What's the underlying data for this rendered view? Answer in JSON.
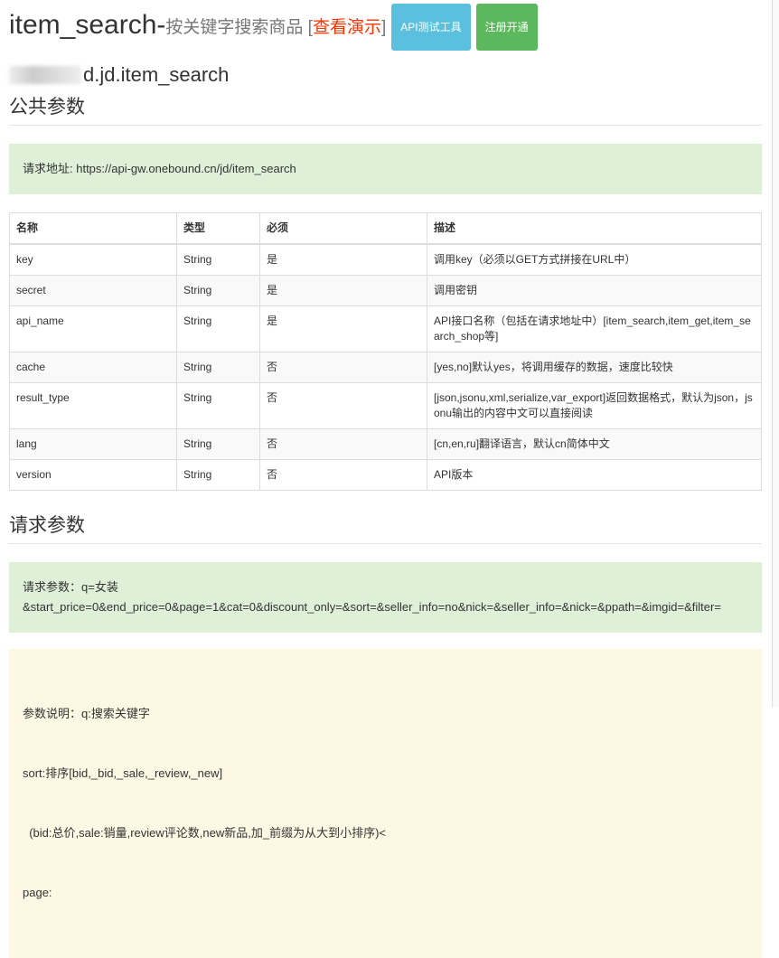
{
  "header": {
    "title": "item_search-",
    "subtitle": "按关键字搜索商品 [",
    "demo": "查看演示",
    "close_bracket": "]",
    "api_test": "API测试工具",
    "register": "注册开通"
  },
  "api_name": "d.jd.item_search",
  "public": {
    "heading": "公共参数",
    "url_label": "请求地址: https://api-gw.onebound.cn/jd/item_search"
  },
  "table": {
    "headers": [
      "名称",
      "类型",
      "必须",
      "描述"
    ],
    "rows": [
      [
        "key",
        "String",
        "是",
        "调用key（必须以GET方式拼接在URL中）"
      ],
      [
        "secret",
        "String",
        "是",
        "调用密钥"
      ],
      [
        "api_name",
        "String",
        "是",
        "API接口名称（包括在请求地址中）[item_search,item_get,item_search_shop等]"
      ],
      [
        "cache",
        "String",
        "否",
        "[yes,no]默认yes，将调用缓存的数据，速度比较快"
      ],
      [
        "result_type",
        "String",
        "否",
        "[json,jsonu,xml,serialize,var_export]返回数据格式，默认为json，jsonu输出的内容中文可以直接阅读"
      ],
      [
        "lang",
        "String",
        "否",
        "[cn,en,ru]翻译语言，默认cn简体中文"
      ],
      [
        "version",
        "String",
        "否",
        "API版本"
      ]
    ]
  },
  "request": {
    "heading": "请求参数",
    "line1": "请求参数：q=女装",
    "line2": "&start_price=0&end_price=0&page=1&cat=0&discount_only=&sort=&seller_info=no&nick=&seller_info=&nick=&ppath=&imgid=&filter="
  },
  "explain": {
    "line1": "参数说明：q:搜索关键字",
    "line2": "sort:排序[bid,_bid,_sale,_review,_new]",
    "line3": "  (bid:总价,sale:销量,review评论数,new新品,加_前缀为从大到小排序)<",
    "line4": "page:"
  }
}
